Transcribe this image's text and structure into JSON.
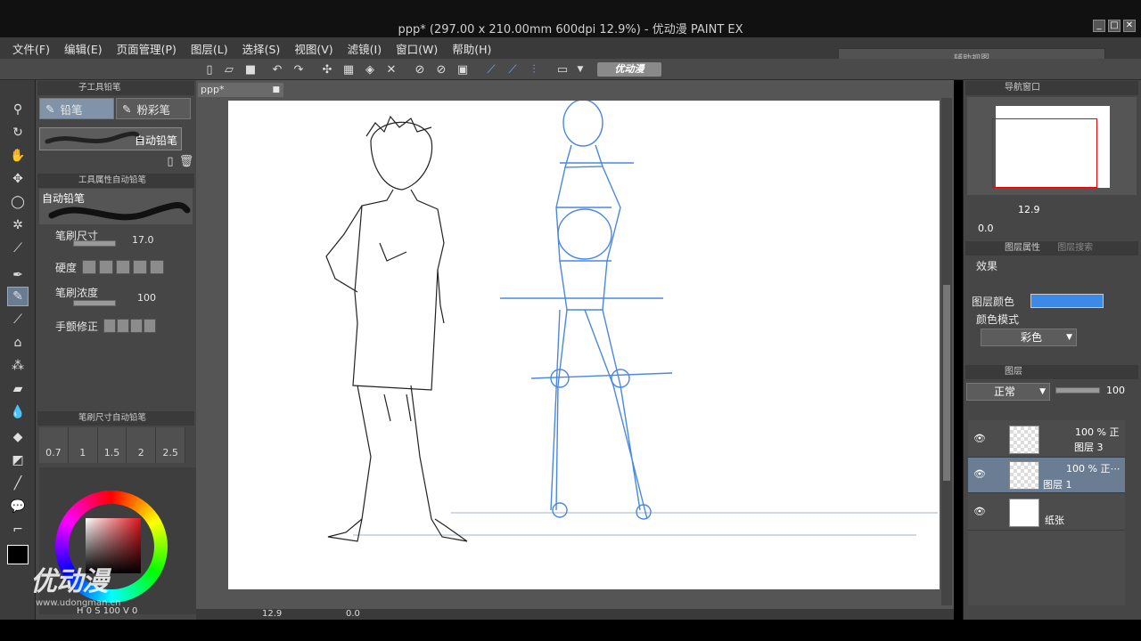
{
  "window": {
    "title": "ppp* (297.00 x 210.00mm 600dpi 12.9%) - 优动漫 PAINT EX",
    "buttons": [
      "_",
      "□",
      "✕"
    ]
  },
  "menu": [
    "文件(F)",
    "编辑(E)",
    "页面管理(P)",
    "图层(L)",
    "选择(S)",
    "视图(V)",
    "滤镜(I)",
    "窗口(W)",
    "帮助(H)"
  ],
  "toolbar": {
    "brand_label": "优动漫",
    "floating_panel_title": "辅助视图"
  },
  "subtool_panel": {
    "header": "子工具铅笔",
    "tabs": [
      "铅笔",
      "粉彩笔"
    ],
    "brush_name": "自动铅笔"
  },
  "tool_property": {
    "header": "工具属性自动铅笔",
    "preview_label": "自动铅笔",
    "brush_size_label": "笔刷尺寸",
    "brush_size_value": "17.0",
    "hardness_label": "硬度",
    "density_label": "笔刷浓度",
    "density_value": "100",
    "stabilization_label": "手颤修正"
  },
  "brush_size_panel": {
    "header": "笔刷尺寸自动铅笔",
    "sizes": [
      "0.7",
      "1",
      "1.5",
      "2",
      "2.5"
    ]
  },
  "color_panel": {
    "watermark": "优动漫",
    "watermark_url": "www.udongman.cn",
    "status_text": "H  0 S 100 V  0",
    "main_color": "#e0141c"
  },
  "document": {
    "tab_label": "ppp*",
    "zoom": "12.9",
    "rotation": "0.0"
  },
  "navigator": {
    "header": "导航窗口",
    "zoom": "12.9",
    "rotation": "0.0"
  },
  "layer_property": {
    "header": "图层属性",
    "header2": "图层搜索",
    "effect_label": "效果",
    "layer_color_label": "图层颜色",
    "layer_color": "#3b8ae8",
    "color_mode_label": "颜色模式",
    "color_mode_value": "彩色"
  },
  "layers_panel": {
    "header": "图层",
    "blend_mode": "正常",
    "opacity": "100",
    "layers": [
      {
        "percent": "100 % 正",
        "name": "图层 3"
      },
      {
        "percent": "100 % 正⋯",
        "name": "图层 1"
      },
      {
        "percent": "",
        "name": "纸张"
      }
    ]
  }
}
